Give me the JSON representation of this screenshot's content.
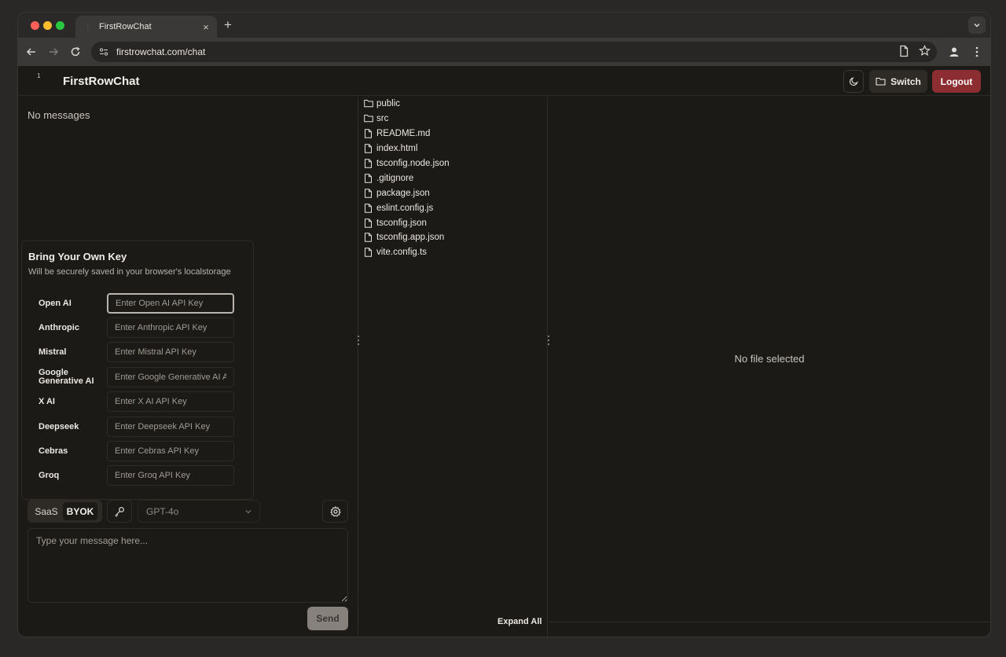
{
  "browser": {
    "tab_title": "FirstRowChat",
    "tab_close": "×",
    "new_tab": "+",
    "url": "firstrowchat.com/chat"
  },
  "header": {
    "logo_mark": "1",
    "brand": "FirstRowChat",
    "switch_label": "Switch",
    "logout_label": "Logout"
  },
  "chat": {
    "empty_text": "No messages",
    "mode_options": [
      "SaaS",
      "BYOK"
    ],
    "selected_mode": "BYOK",
    "model": "GPT-4o",
    "message_placeholder": "Type your message here...",
    "send_label": "Send"
  },
  "byok": {
    "title": "Bring Your Own Key",
    "subtitle": "Will be securely saved in your browser's localstorage",
    "providers": [
      {
        "label": "Open AI",
        "placeholder": "Enter Open AI API Key"
      },
      {
        "label": "Anthropic",
        "placeholder": "Enter Anthropic API Key"
      },
      {
        "label": "Mistral",
        "placeholder": "Enter Mistral API Key"
      },
      {
        "label": "Google Generative AI",
        "placeholder": "Enter Google Generative AI API Key"
      },
      {
        "label": "X AI",
        "placeholder": "Enter X AI API Key"
      },
      {
        "label": "Deepseek",
        "placeholder": "Enter Deepseek API Key"
      },
      {
        "label": "Cebras",
        "placeholder": "Enter Cebras API Key"
      },
      {
        "label": "Groq",
        "placeholder": "Enter Groq API Key"
      }
    ]
  },
  "file_tree": {
    "items": [
      {
        "name": "public",
        "type": "folder"
      },
      {
        "name": "src",
        "type": "folder"
      },
      {
        "name": "README.md",
        "type": "file"
      },
      {
        "name": "index.html",
        "type": "file"
      },
      {
        "name": "tsconfig.node.json",
        "type": "file"
      },
      {
        "name": ".gitignore",
        "type": "file"
      },
      {
        "name": "package.json",
        "type": "file"
      },
      {
        "name": "eslint.config.js",
        "type": "file"
      },
      {
        "name": "tsconfig.json",
        "type": "file"
      },
      {
        "name": "tsconfig.app.json",
        "type": "file"
      },
      {
        "name": "vite.config.ts",
        "type": "file"
      }
    ],
    "expand_all_label": "Expand All"
  },
  "viewer": {
    "empty_text": "No file selected"
  },
  "colors": {
    "background": "#1c1a17",
    "logout": "#8c2d32",
    "send_disabled": "#86817b"
  }
}
